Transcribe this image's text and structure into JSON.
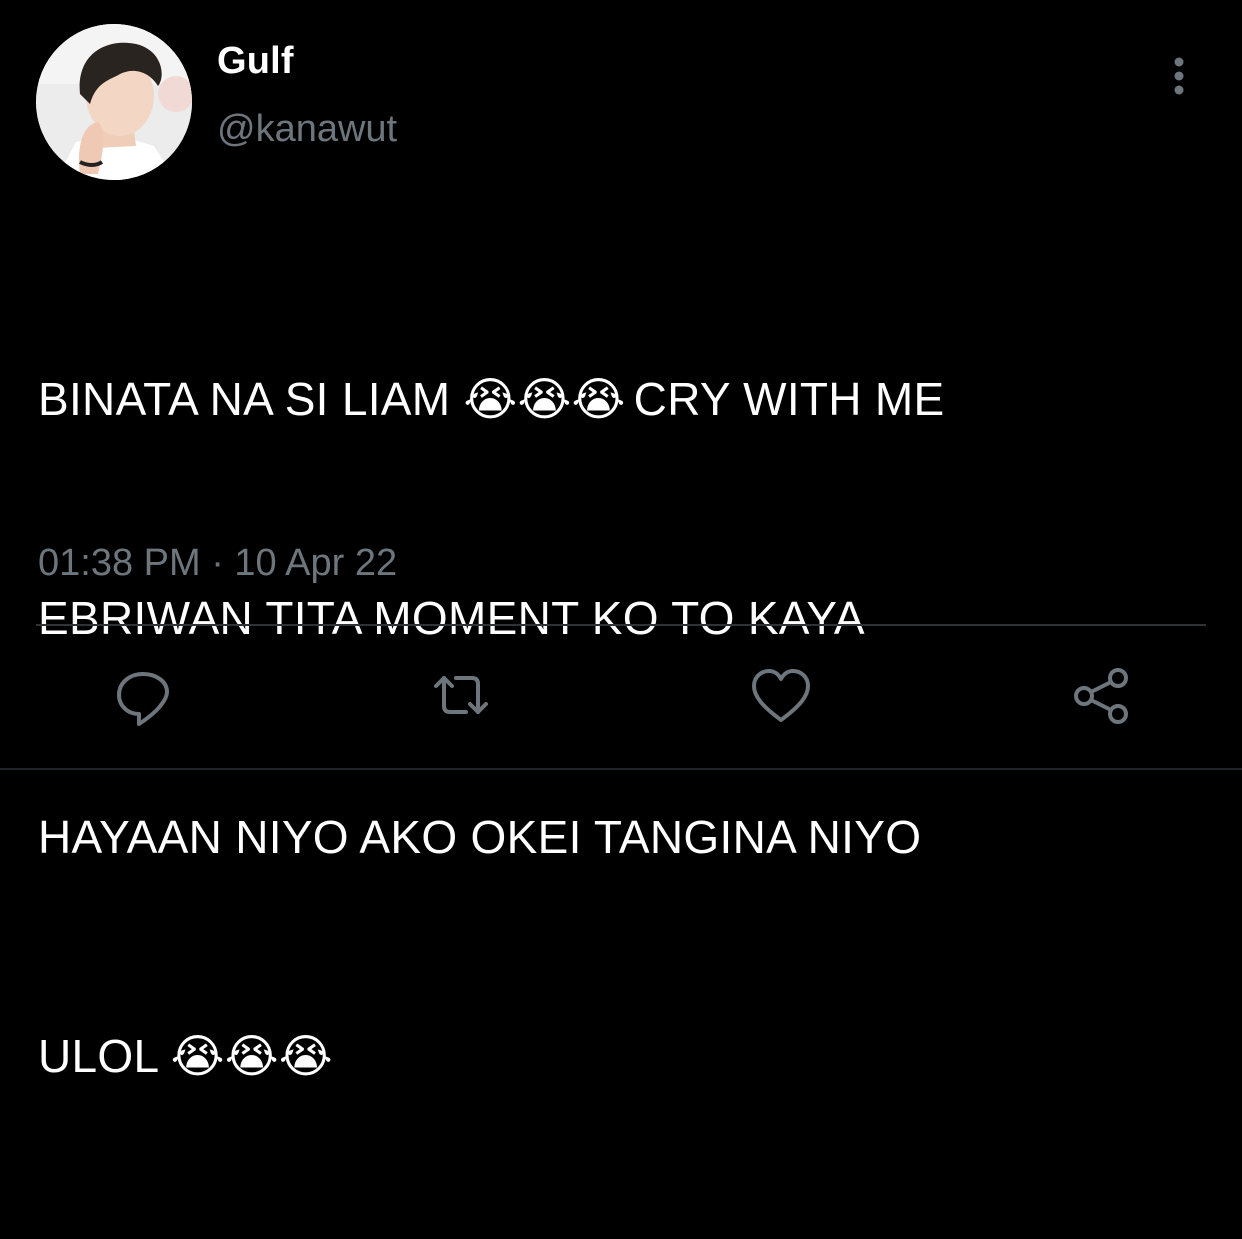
{
  "tweet": {
    "author": {
      "display_name": "Gulf",
      "handle": "@kanawut",
      "avatar_icon": "profile-photo"
    },
    "more_icon": "vertical-dots-icon",
    "text_lines": [
      {
        "before": "BINATA NA SI LIAM",
        "emoji": "😭😭😭",
        "after": "CRY WITH ME"
      },
      {
        "text": "EBRIWAN TITA MOMENT KO TO KAYA"
      },
      {
        "text": "HAYAAN NIYO AKO OKEI TANGINA NIYO"
      },
      {
        "before": "ULOL",
        "emoji": "😭😭😭"
      }
    ],
    "timestamp": "01:38 PM · 10 Apr 22",
    "actions": [
      {
        "name": "reply",
        "icon": "reply-bubble-icon"
      },
      {
        "name": "retweet",
        "icon": "retweet-icon"
      },
      {
        "name": "like",
        "icon": "heart-icon"
      },
      {
        "name": "share",
        "icon": "share-icon"
      }
    ],
    "colors": {
      "background": "#000000",
      "text": "#ffffff",
      "secondary_text": "#6e767d",
      "divider": "#2f3336",
      "action_icon": "#6e767d"
    }
  }
}
